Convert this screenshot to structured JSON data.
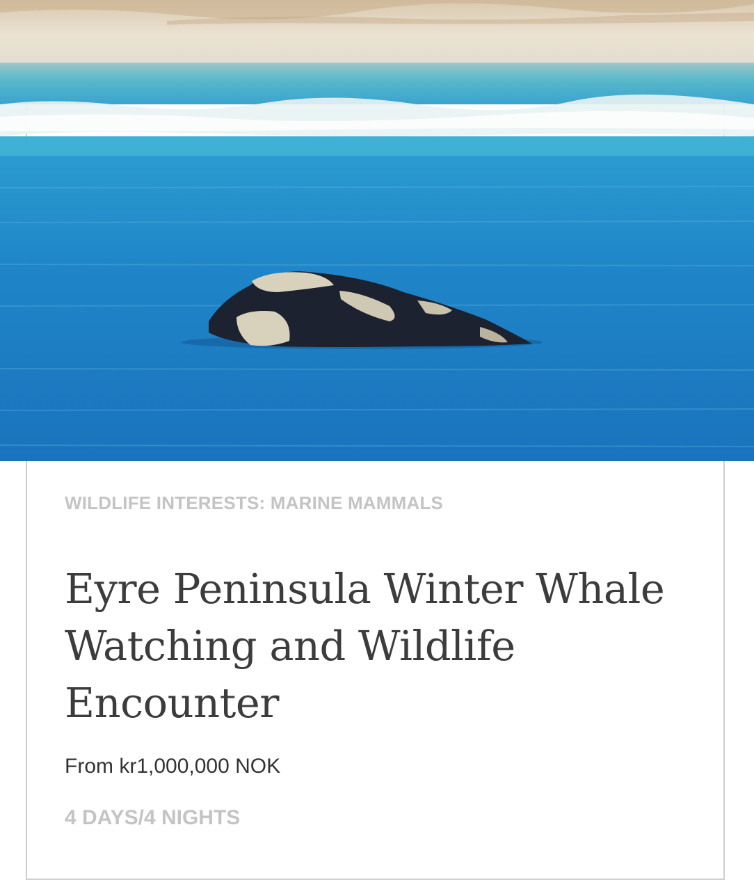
{
  "tour_card": {
    "image": {
      "subject": "whale-surfacing-photo",
      "colors": {
        "sand": "#e6dccb",
        "shallow_water": "#52b9c8",
        "deep_water": "#1f7fc4",
        "whale": "#1c2230",
        "callosity": "#d8d2bd"
      }
    },
    "category": "WILDLIFE INTERESTS: MARINE MAMMALS",
    "title": "Eyre Peninsula Winter Whale Watching and Wildlife Encounter",
    "price": "From kr1,000,000 NOK",
    "duration": "4 DAYS/4 NIGHTS"
  }
}
